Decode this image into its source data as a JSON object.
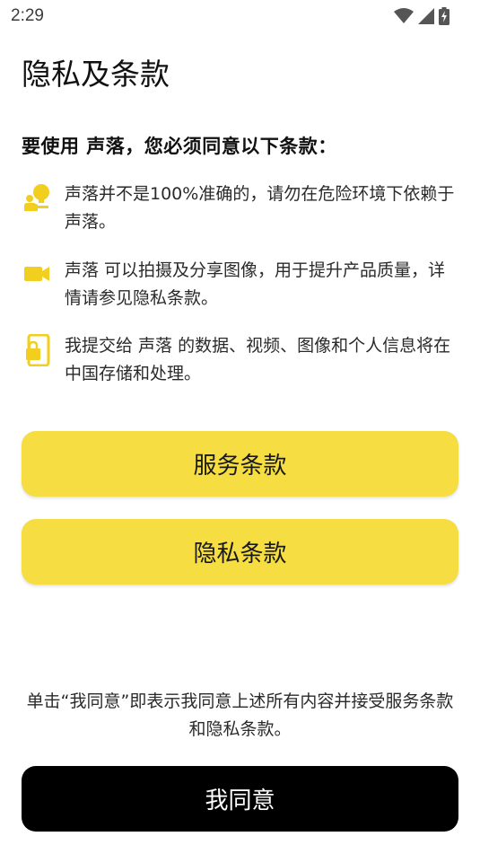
{
  "status_bar": {
    "time": "2:29",
    "icons": [
      "wifi-icon",
      "cellular-signal-icon",
      "battery-charging-icon"
    ]
  },
  "page": {
    "title": "隐私及条款",
    "subtitle": "要使用 声落，您必须同意以下条款："
  },
  "notices": [
    {
      "icon": "person-bulb-icon",
      "text": "声落并不是100%准确的，请勿在危险环境下依赖于声落。"
    },
    {
      "icon": "video-camera-icon",
      "text": "声落 可以拍摄及分享图像，用于提升产品质量，详情请参见隐私条款。"
    },
    {
      "icon": "phone-lock-icon",
      "text": "我提交给 声落 的数据、视频、图像和个人信息将在中国存储和处理。"
    }
  ],
  "buttons": {
    "terms_of_service": "服务条款",
    "privacy_terms": "隐私条款",
    "agree": "我同意"
  },
  "consent_text": "单击“我同意”即表示我同意上述所有内容并接受服务条款和隐私条款。",
  "colors": {
    "accent_yellow": "#f5dd42",
    "icon_yellow": "#f2cf1f",
    "primary_black": "#000000"
  }
}
